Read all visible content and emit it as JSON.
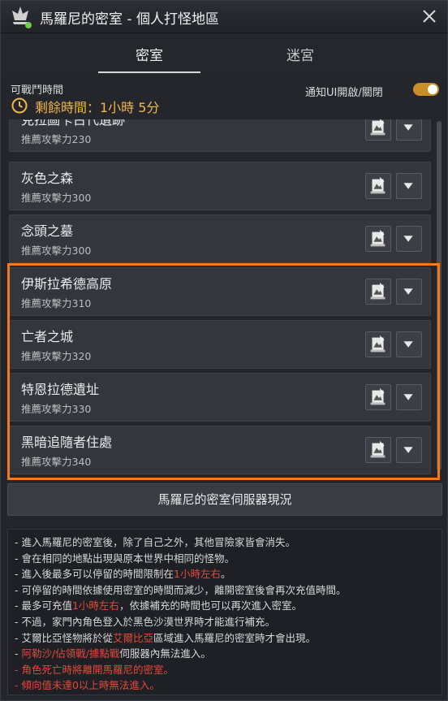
{
  "window": {
    "title": "馬羅尼的密室 - 個人打怪地區",
    "close_icon": "close-icon",
    "app_icon": "crown-emblem-icon"
  },
  "tabs": [
    {
      "label": "密室",
      "active": true
    },
    {
      "label": "迷宮",
      "active": false
    }
  ],
  "timer": {
    "label": "可戰鬥時間",
    "remaining": "剩餘時間：1小時 5分",
    "icon": "clock-icon"
  },
  "notify": {
    "label": "通知UI開啟/關閉",
    "enabled": true
  },
  "rooms": [
    {
      "name": "克拉圖卡古代遺跡",
      "power": "推薦攻擊力230"
    },
    {
      "name": "灰色之森",
      "power": "推薦攻擊力300"
    },
    {
      "name": "念頭之墓",
      "power": "推薦攻擊力300"
    },
    {
      "name": "伊斯拉希德高原",
      "power": "推薦攻擊力310"
    },
    {
      "name": "亡者之城",
      "power": "推薦攻擊力320"
    },
    {
      "name": "特恩拉德遺址",
      "power": "推薦攻擊力330"
    },
    {
      "name": "黑暗追隨者住處",
      "power": "推薦攻擊力340"
    }
  ],
  "server_button": "馬羅尼的密室伺服器現況",
  "notes": [
    {
      "parts": [
        {
          "text": "- 進入馬羅尼的密室後，除了自己之外，其他冒險家皆會消失。"
        }
      ]
    },
    {
      "parts": [
        {
          "text": "- 會在相同的地點出現與原本世界中相同的怪物。"
        }
      ]
    },
    {
      "parts": [
        {
          "text": "- 進入後最多可以停留的時間限制在"
        },
        {
          "text": "1小時左右",
          "hl": true
        },
        {
          "text": "。"
        }
      ]
    },
    {
      "parts": [
        {
          "text": "- 可停留的時間依據使用密室的時間而減少，離開密室後會再次充值時間。"
        }
      ]
    },
    {
      "parts": [
        {
          "text": "- 最多可充值"
        },
        {
          "text": "1小時左右",
          "hl": true
        },
        {
          "text": "，依據補充的時間也可以再次進入密室。"
        }
      ]
    },
    {
      "parts": [
        {
          "text": "- 不過，家門內角色登入於黑色沙漠世界時才能進行補充。"
        }
      ]
    },
    {
      "parts": [
        {
          "text": "- 艾爾比亞怪物將於從"
        },
        {
          "text": "艾爾比亞",
          "hl": true
        },
        {
          "text": "區域進入馬羅尼的密室時才會出現。"
        }
      ]
    },
    {
      "parts": [
        {
          "text": "- "
        },
        {
          "text": "阿勒沙/佔領戰/據點戰",
          "hl": true
        },
        {
          "text": "伺服器內無法進入。"
        }
      ]
    },
    {
      "parts": [
        {
          "text": "- 角色死亡時將離開馬羅尼的密室。",
          "hl": true
        }
      ]
    },
    {
      "parts": [
        {
          "text": "- 傾向值未達0以上時無法進入。",
          "hl": true
        }
      ]
    }
  ],
  "colors": {
    "accent_orange": "#f07a1c",
    "timer_gold": "#f0b74a",
    "warning_red": "#e2493a",
    "toggle_on": "#c98d2a"
  }
}
